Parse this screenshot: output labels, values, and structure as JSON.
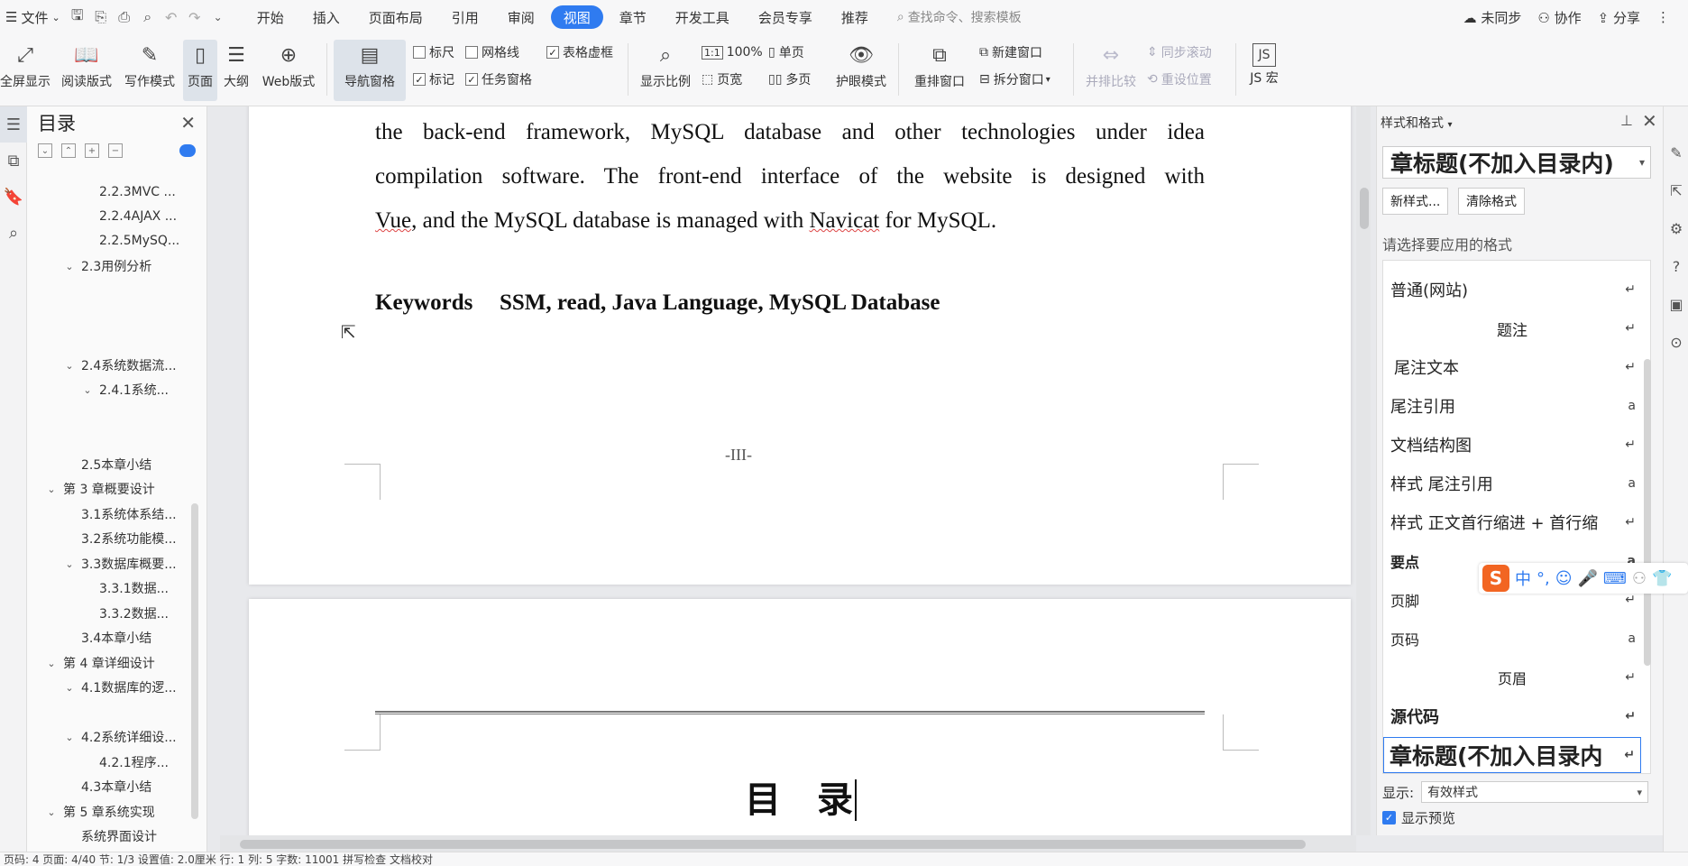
{
  "menubar": {
    "file": "文件",
    "tabs": [
      {
        "label": "开始",
        "active": false
      },
      {
        "label": "插入",
        "active": false
      },
      {
        "label": "页面布局",
        "active": false
      },
      {
        "label": "引用",
        "active": false
      },
      {
        "label": "审阅",
        "active": false
      },
      {
        "label": "视图",
        "active": true
      },
      {
        "label": "章节",
        "active": false
      },
      {
        "label": "开发工具",
        "active": false
      },
      {
        "label": "会员专享",
        "active": false
      },
      {
        "label": "推荐",
        "active": false
      }
    ],
    "search_placeholder": "查找命令、搜索模板",
    "unsync": "未同步",
    "collab": "协作",
    "share": "分享"
  },
  "ribbon": {
    "fullscreen": "全屏显示",
    "reading": "阅读版式",
    "writing": "写作模式",
    "page": "页面",
    "outline": "大纲",
    "web": "Web版式",
    "nav_pane": "导航窗格",
    "ruler": "标尺",
    "gridlines": "网格线",
    "table_gridlines": "表格虚框",
    "marks": "标记",
    "task_pane": "任务窗格",
    "zoom_ratio": "显示比例",
    "zoom_100": "100%",
    "single_page": "单页",
    "page_width": "页宽",
    "multi_page": "多页",
    "eye_care": "护眼模式",
    "rearrange": "重排窗口",
    "new_window": "新建窗口",
    "split_window": "拆分窗口",
    "side_by_side": "并排比较",
    "sync_scroll": "同步滚动",
    "reset_pos": "重设位置",
    "js_macro": "JS 宏"
  },
  "toc": {
    "title": "目录",
    "items": [
      {
        "label": "2.2.3MVC ...",
        "level": 3,
        "expandable": false
      },
      {
        "label": "2.2.4AJAX ...",
        "level": 3,
        "expandable": false
      },
      {
        "label": "2.2.5MySQ...",
        "level": 3,
        "expandable": false
      },
      {
        "label": "2.3用例分析",
        "level": 2,
        "expandable": true
      },
      {
        "label": "2.4系统数据流...",
        "level": 2,
        "expandable": true
      },
      {
        "label": "2.4.1系统...",
        "level": 3,
        "expandable": true
      },
      {
        "label": "2.5本章小结",
        "level": 2,
        "expandable": false
      },
      {
        "label": "第 3 章概要设计",
        "level": 1,
        "expandable": true
      },
      {
        "label": "3.1系统体系结...",
        "level": 2,
        "expandable": false
      },
      {
        "label": "3.2系统功能模...",
        "level": 2,
        "expandable": false
      },
      {
        "label": "3.3数据库概要...",
        "level": 2,
        "expandable": true
      },
      {
        "label": "3.3.1数据...",
        "level": 3,
        "expandable": false
      },
      {
        "label": "3.3.2数据...",
        "level": 3,
        "expandable": false
      },
      {
        "label": "3.4本章小结",
        "level": 2,
        "expandable": false
      },
      {
        "label": "第 4 章详细设计",
        "level": 1,
        "expandable": true
      },
      {
        "label": "4.1数据库的逻...",
        "level": 2,
        "expandable": true
      },
      {
        "label": "4.2系统详细设...",
        "level": 2,
        "expandable": true
      },
      {
        "label": "4.2.1程序...",
        "level": 3,
        "expandable": false
      },
      {
        "label": "4.3本章小结",
        "level": 2,
        "expandable": false
      },
      {
        "label": "第 5 章系统实现",
        "level": 1,
        "expandable": true
      },
      {
        "label": "系统界面设计",
        "level": 2,
        "expandable": false
      }
    ]
  },
  "document": {
    "para_line1": "the back-end framework, MySQL database and other technologies under idea",
    "para_line2": "compilation software. The front-end interface of the website is designed with",
    "para_line3_a": "Vue",
    "para_line3_b": ", and the MySQL database is managed with ",
    "para_line3_c": "Navicat",
    "para_line3_d": " for MySQL.",
    "keywords_label": "Keywords",
    "keywords_value": "SSM, read, Java Language, MySQL Database",
    "page_number": "-III-",
    "next_heading": "目　录"
  },
  "style_panel": {
    "title": "样式和格式",
    "current_style": "章标题(不加入目录内)",
    "new_style": "新样式...",
    "clear_format": "清除格式",
    "choose_label": "请选择要应用的格式",
    "styles": [
      {
        "name": "普通(网站)",
        "mark": "↵",
        "align": "left"
      },
      {
        "name": "题注",
        "mark": "↵",
        "align": "center"
      },
      {
        "name": "尾注文本",
        "mark": "↵",
        "align": "left"
      },
      {
        "name": "尾注引用",
        "mark": "a",
        "align": "left"
      },
      {
        "name": "文档结构图",
        "mark": "↵",
        "align": "left"
      },
      {
        "name": "样式  尾注引用",
        "mark": "a",
        "align": "left"
      },
      {
        "name": "样式  正文首行缩进 + 首行缩",
        "mark": "↵",
        "align": "left"
      },
      {
        "name": "要点",
        "mark": "a",
        "align": "left"
      },
      {
        "name": "页脚",
        "mark": "↵",
        "align": "left"
      },
      {
        "name": "页码",
        "mark": "a",
        "align": "left"
      },
      {
        "name": "页眉",
        "mark": "↵",
        "align": "center"
      },
      {
        "name": "源代码",
        "mark": "↵",
        "align": "left"
      },
      {
        "name": "章标题(不加入目录内",
        "mark": "↵",
        "align": "left"
      }
    ],
    "show_label": "显示:",
    "show_value": "有效样式",
    "preview_label": "显示预览"
  },
  "ime": {
    "logo": "S",
    "mode": "中"
  },
  "statusbar": {
    "text": "页码: 4   页面: 4/40   节: 1/3   设置值: 2.0厘米   行: 1   列: 5   字数: 11001   拼写检查   文档校对"
  }
}
